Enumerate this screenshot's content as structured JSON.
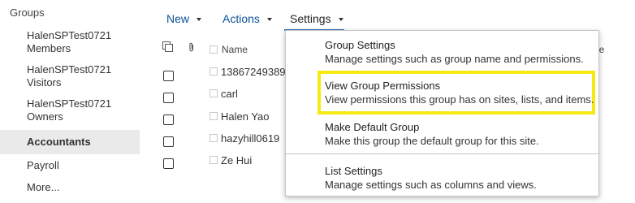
{
  "leftnav": {
    "heading": "Groups",
    "items": [
      {
        "line1": "HalenSPTest0721",
        "line2": "Members"
      },
      {
        "line1": "HalenSPTest0721",
        "line2": "Visitors"
      },
      {
        "line1": "HalenSPTest0721",
        "line2": "Owners"
      },
      {
        "label": "Accountants",
        "selected": true
      },
      {
        "label": "Payroll"
      },
      {
        "label": "More..."
      }
    ]
  },
  "toolbar": {
    "new_label": "New",
    "actions_label": "Actions",
    "settings_label": "Settings"
  },
  "list": {
    "name_header": "Name",
    "cut_column_text": "le",
    "rows": [
      {
        "name": "13867249389"
      },
      {
        "name": "carl"
      },
      {
        "name": "Halen Yao"
      },
      {
        "name": "hazyhill0619"
      },
      {
        "name": "Ze Hui"
      }
    ]
  },
  "settings_menu": {
    "items": [
      {
        "title": "Group Settings",
        "description": "Manage settings such as group name and permissions."
      },
      {
        "title": "View Group Permissions",
        "description": "View permissions this group has on sites, lists, and items.",
        "highlighted": true
      },
      {
        "title": "Make Default Group",
        "description": "Make this group the default group for this site."
      },
      {
        "title": "List Settings",
        "description": "Manage settings such as columns and views."
      }
    ]
  },
  "colors": {
    "link_blue": "#0b5394",
    "selected_bg": "#eaeaea",
    "highlight_yellow": "#f5ea14",
    "underline_blue": "#2b6cb5"
  }
}
